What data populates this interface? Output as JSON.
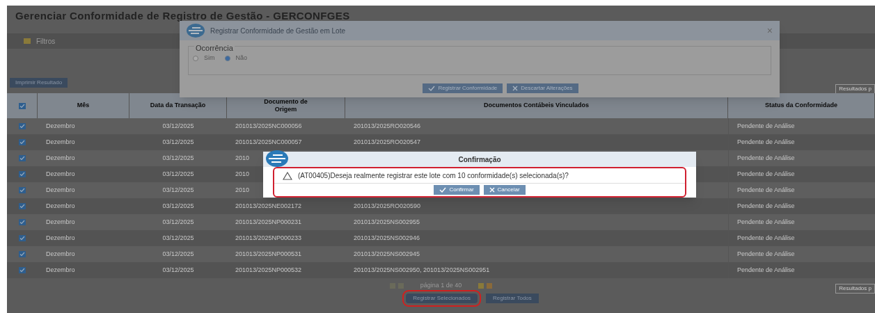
{
  "page": {
    "title": "Gerenciar Conformidade de Registro de Gestão - GERCONFGES",
    "filters_label": "Filtros",
    "print_button": "Imprimir Resultado",
    "results_top": "Resultados p",
    "results_bottom": "Resultados p"
  },
  "table": {
    "all_selected": true,
    "columns": [
      "Mês",
      "Data da Transação",
      "Documento de Origem",
      "Documentos Contábeis Vinculados",
      "Status da Conformidade"
    ],
    "rows": [
      {
        "selected": true,
        "cells": [
          "Dezembro",
          "03/12/2025",
          "201013/2025NC000056",
          "201013/2025RO020546",
          "Pendente de Análise"
        ]
      },
      {
        "selected": true,
        "cells": [
          "Dezembro",
          "03/12/2025",
          "201013/2025NC000057",
          "201013/2025RO020547",
          "Pendente de Análise"
        ]
      },
      {
        "selected": true,
        "cells": [
          "Dezembro",
          "03/12/2025",
          "2010",
          "",
          "Pendente de Análise"
        ]
      },
      {
        "selected": true,
        "cells": [
          "Dezembro",
          "03/12/2025",
          "2010",
          "",
          "Pendente de Análise"
        ]
      },
      {
        "selected": true,
        "cells": [
          "Dezembro",
          "03/12/2025",
          "2010",
          "",
          "Pendente de Análise"
        ]
      },
      {
        "selected": true,
        "cells": [
          "Dezembro",
          "03/12/2025",
          "201013/2025NE002172",
          "201013/2025RO020590",
          "Pendente de Análise"
        ]
      },
      {
        "selected": true,
        "cells": [
          "Dezembro",
          "03/12/2025",
          "201013/2025NP000231",
          "201013/2025NS002955",
          "Pendente de Análise"
        ]
      },
      {
        "selected": true,
        "cells": [
          "Dezembro",
          "03/12/2025",
          "201013/2025NP000233",
          "201013/2025NS002946",
          "Pendente de Análise"
        ]
      },
      {
        "selected": true,
        "cells": [
          "Dezembro",
          "03/12/2025",
          "201013/2025NP000531",
          "201013/2025NS002945",
          "Pendente de Análise"
        ]
      },
      {
        "selected": true,
        "cells": [
          "Dezembro",
          "03/12/2025",
          "201013/2025NP000532",
          "201013/2025NS002950, 201013/2025NS002951",
          "Pendente de Análise"
        ]
      }
    ]
  },
  "pagination": {
    "label": "página 1 de 40"
  },
  "actions": [
    {
      "label": "Registrar Selecionados",
      "highlighted": true
    },
    {
      "label": "Registrar Todos",
      "highlighted": false
    }
  ],
  "batch_dialog": {
    "title": "Registrar Conformidade de Gestão em Lote",
    "close": "×",
    "legend": "Ocorrência",
    "options": [
      {
        "label": "Sim",
        "selected": false
      },
      {
        "label": "Não",
        "selected": true
      }
    ],
    "buttons": [
      {
        "kind": "confirm",
        "label": "Registrar Conformidade"
      },
      {
        "kind": "cancel",
        "label": "Descartar Alterações"
      }
    ]
  },
  "confirm_dialog": {
    "title": "Confirmação",
    "message": "(AT00405)Deseja realmente registrar este lote com 10 conformidade(s) selecionada(s)?",
    "highlighted": true,
    "buttons": [
      {
        "kind": "confirm",
        "label": "Confirmar"
      },
      {
        "kind": "cancel",
        "label": "Cancelar"
      }
    ]
  }
}
